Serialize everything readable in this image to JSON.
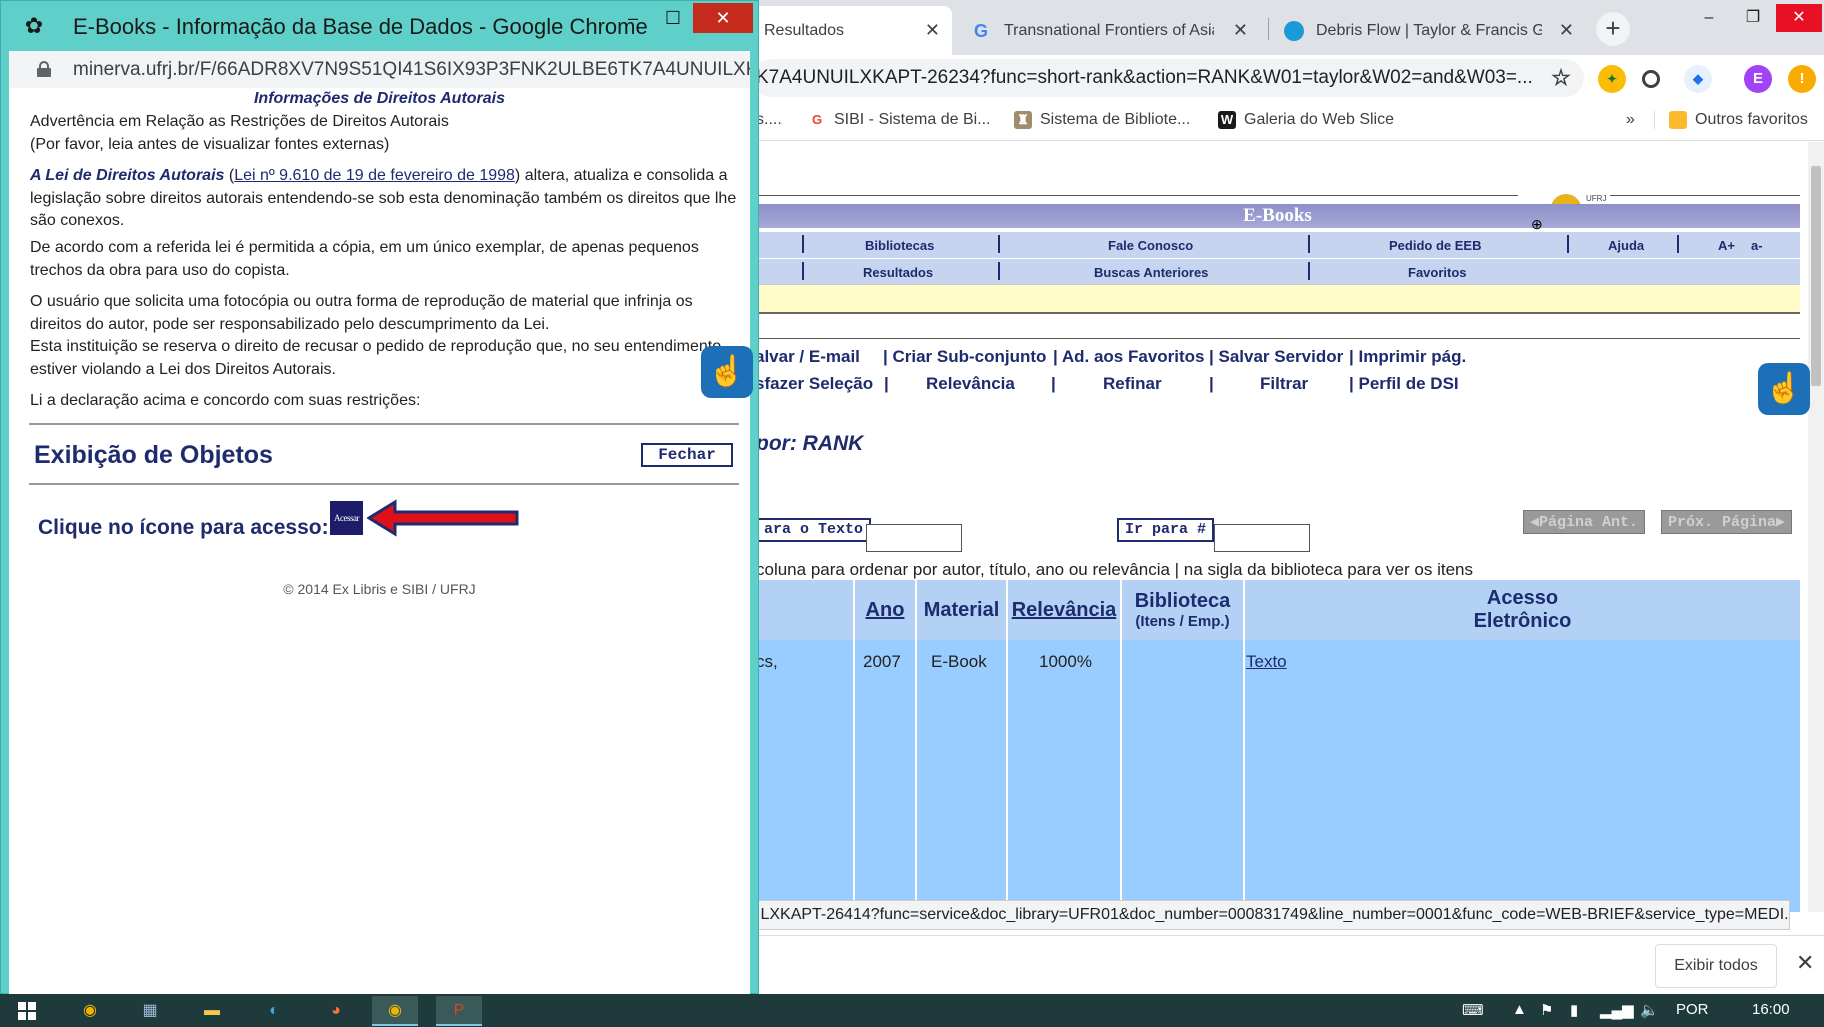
{
  "background_window": {
    "tabs": [
      {
        "title": "Resultados",
        "close": "✕"
      },
      {
        "title": "Transnational Frontiers of Asia a",
        "close": "✕"
      },
      {
        "title": "Debris Flow | Taylor & Francis G",
        "close": "✕"
      }
    ],
    "new_tab": "+",
    "omnibox_url": "K7A4UNUILXKAPT-26234?func=short-rank&action=RANK&W01=taylor&W02=and&W03=...",
    "profile_initial": "E",
    "bookmarks": [
      {
        "label": "s....",
        "icon": ""
      },
      {
        "label": "SIBI - Sistema de Bi...",
        "icon": "G"
      },
      {
        "label": "Sistema de Bibliote...",
        "icon": "♜"
      },
      {
        "label": "Galeria do Web Slice",
        "icon": "W"
      }
    ],
    "bookmarks_more": "»",
    "other_bookmarks": "Outros favoritos",
    "page": {
      "band_title": "E-Books",
      "logo_text": "UFRJ SIBI",
      "nav_row1": [
        "Bibliotecas",
        "Fale Conosco",
        "Pedido de EEB",
        "Ajuda",
        "A+",
        "a-"
      ],
      "nav_row2": [
        "Resultados",
        "Buscas Anteriores",
        "Favoritos"
      ],
      "actions_row1": [
        "alvar / E-mail",
        "Criar Sub-conjunto",
        "Ad. aos Favoritos",
        "Salvar Servidor",
        "Imprimir pág."
      ],
      "actions_row2": [
        "sfazer Seleção",
        "Relevância",
        "Refinar",
        "Filtrar",
        "Perfil de DSI"
      ],
      "sort_label": "por: RANK",
      "go_text_btn": "ara o Texto",
      "go_number_btn": "Ir para #",
      "prev_page_btn": "◀Página Ant.",
      "next_page_btn": "Próx. Página▶",
      "hint": "coluna para ordenar por autor, título, ano ou relevância | na sigla da biblioteca para ver os itens",
      "table": {
        "headers": [
          "Ano",
          "Material",
          "Relevância",
          "Biblioteca",
          "(Itens / Emp.)",
          "Acesso",
          "Eletrônico"
        ],
        "row": {
          "title_fragment": "cs,",
          "year": "2007",
          "material": "E-Book",
          "relevance": "1000%",
          "library": "",
          "access": "Texto"
        }
      }
    },
    "status_url": "ILXKAPT-26414?func=service&doc_library=UFR01&doc_number=000831749&line_number=0001&func_code=WEB-BRIEF&service_type=MEDI...",
    "download_bar": {
      "show_all": "Exibir todos",
      "close": "✕"
    }
  },
  "popup": {
    "title": "E-Books - Informação da Base de Dados - Google Chrome",
    "url": "minerva.ufrj.br/F/66ADR8XV7N9S51QI41S6IX93P3FNK2ULBE6TK7A4UNUILXK...",
    "copyright_header": "Informações de Direitos Autorais",
    "warning_line1": "Advertência em Relação as Restrições de Direitos Autorais",
    "warning_line2": "(Por favor, leia antes de visualizar fontes externas)",
    "law_name": "A Lei de Direitos Autorais",
    "law_link": "Lei nº 9.610 de 19 de fevereiro de 1998",
    "law_text_after": ") altera, atualiza e consolida a legislação sobre direitos autorais entendendo-se sob esta denominação também os direitos que lhe são conexos.",
    "para_copy": "De acordo com a referida lei é permitida a cópia, em um único exemplar, de apenas pequenos trechos da obra para uso do copista.",
    "para_user": "O usuário que solicita uma fotocópia ou outra forma de reprodução de material que infrinja os direitos do autor, pode ser responsabilizado pelo descumprimento da Lei.",
    "para_institution": "Esta instituição se reserva o direito de recusar o pedido de reprodução que, no seu entendimento, estiver violando a Lei dos Direitos Autorais.",
    "para_agree": "Li a declaração acima e concordo com suas restrições:",
    "objects_heading": "Exibição de Objetos",
    "close_button": "Fechar",
    "access_label": "Clique no ícone para acesso:",
    "access_icon_text": "Acessar",
    "copyright_footer": "© 2014 Ex Libris e SIBI / UFRJ"
  },
  "taskbar": {
    "language": "POR",
    "clock": "16:00"
  },
  "colors": {
    "popup_frame": "#5ed0c9",
    "nav_blue": "#1e2b6e",
    "table_blue": "#99ccff",
    "arrow_red": "#e0101a"
  }
}
